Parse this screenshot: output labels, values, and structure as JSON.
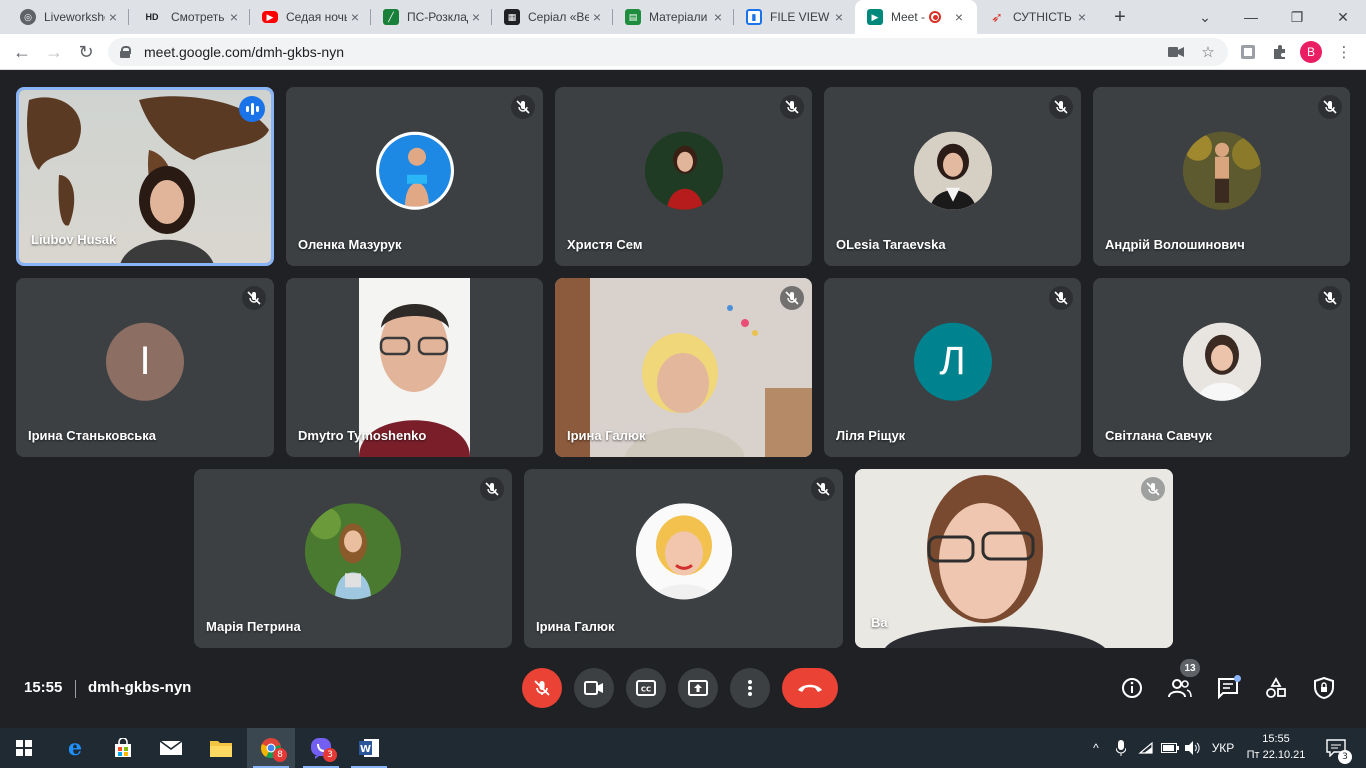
{
  "browser": {
    "tabs": [
      {
        "title": "Liveworksheets",
        "icon": "globe-icon",
        "color": "#5f6368"
      },
      {
        "title": "Смотреть онлайн",
        "icon": "hd-icon",
        "color": "#202124"
      },
      {
        "title": "Седая ночь",
        "icon": "youtube-icon",
        "color": "#ff0000"
      },
      {
        "title": "ПС-Розклад",
        "icon": "sheets-icon",
        "color": "#188038"
      },
      {
        "title": "Серіал «Ветер",
        "icon": "clapper-icon",
        "color": "#202124"
      },
      {
        "title": "Матеріали",
        "icon": "classroom-icon",
        "color": "#1e8e3e"
      },
      {
        "title": "FILE VIEW",
        "icon": "file-icon",
        "color": "#1a73e8"
      },
      {
        "title": "Meet - ",
        "icon": "meet-icon",
        "color": "#00897b",
        "active": true
      },
      {
        "title": "СУТНІСТЬ",
        "icon": "pen-icon",
        "color": "#d93025"
      }
    ],
    "url": "meet.google.com/dmh-gkbs-nyn",
    "profile_initial": "B",
    "hd_label": "HD"
  },
  "participants": [
    {
      "name": "Liubov Husak",
      "type": "video",
      "speaking": true
    },
    {
      "name": "Оленка Мазурук",
      "type": "avatar",
      "avatar_color": "#1e88e5"
    },
    {
      "name": "Христя Сем",
      "type": "avatar",
      "avatar_color": "#8d1f24"
    },
    {
      "name": "OLesia Taraevska",
      "type": "avatar",
      "avatar_color": "#5d4a44"
    },
    {
      "name": "Андрій Волошинович",
      "type": "avatar",
      "avatar_color": "#6b5a33"
    },
    {
      "name": "Ірина Станьковська",
      "type": "letter",
      "letter": "І",
      "avatar_color": "#8d6e63"
    },
    {
      "name": "Dmytro Tymoshenko",
      "type": "video"
    },
    {
      "name": "Ірина Галюк",
      "type": "video"
    },
    {
      "name": "Ліля Ріщук",
      "type": "letter",
      "letter": "Л",
      "avatar_color": "#00838f"
    },
    {
      "name": "Світлана Савчук",
      "type": "avatar",
      "avatar_color": "#e5e0dc"
    },
    {
      "name": "Марія Петрина",
      "type": "avatar",
      "avatar_color": "#3d6b2f"
    },
    {
      "name": "Ірина Галюк",
      "type": "avatar",
      "avatar_color": "#f0c040"
    },
    {
      "name": "Ва",
      "type": "video",
      "self": true
    }
  ],
  "meeting": {
    "time": "15:55",
    "code": "dmh-gkbs-nyn",
    "participant_count": "13",
    "controls": [
      "mic-off-icon",
      "camera-icon",
      "captions-icon",
      "present-icon",
      "more-icon",
      "hangup-icon"
    ],
    "right_controls": [
      "info-icon",
      "people-icon",
      "chat-icon",
      "activities-icon",
      "host-controls-icon"
    ]
  },
  "taskbar": {
    "apps": [
      {
        "name": "edge",
        "badge": ""
      },
      {
        "name": "store",
        "badge": ""
      },
      {
        "name": "mail",
        "badge": ""
      },
      {
        "name": "explorer",
        "badge": ""
      },
      {
        "name": "chrome",
        "badge": "8"
      },
      {
        "name": "viber",
        "badge": "3"
      },
      {
        "name": "word",
        "badge": ""
      }
    ],
    "language": "УКР",
    "time": "15:55",
    "date": "Пт 22.10.21",
    "notifications": "3"
  }
}
